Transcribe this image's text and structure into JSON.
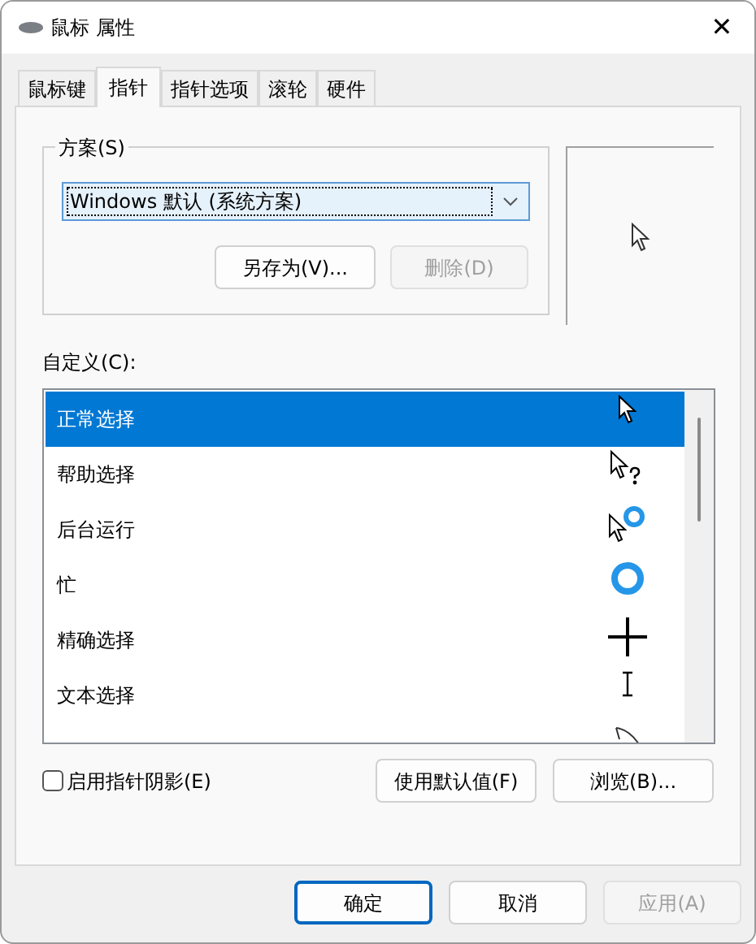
{
  "window": {
    "title": "鼠标 属性",
    "close": "✕"
  },
  "tabs": [
    {
      "label": "鼠标键",
      "selected": false
    },
    {
      "label": "指针",
      "selected": true
    },
    {
      "label": "指针选项",
      "selected": false
    },
    {
      "label": "滚轮",
      "selected": false
    },
    {
      "label": "硬件",
      "selected": false
    }
  ],
  "scheme": {
    "label": "方案(S)",
    "value": "Windows 默认 (系统方案)",
    "buttons": [
      {
        "label": "另存为(V)...",
        "disabled": false
      },
      {
        "label": "删除(D)",
        "disabled": true
      }
    ]
  },
  "customize": {
    "label": "自定义(C):",
    "rows": [
      {
        "label": "正常选择",
        "kind": "arrow",
        "selected": true
      },
      {
        "label": "帮助选择",
        "kind": "help",
        "selected": false
      },
      {
        "label": "后台运行",
        "kind": "working",
        "selected": false
      },
      {
        "label": "忙",
        "kind": "busy",
        "selected": false
      },
      {
        "label": "精确选择",
        "kind": "cross",
        "selected": false
      },
      {
        "label": "文本选择",
        "kind": "text",
        "selected": false
      },
      {
        "kind": "pen",
        "selected": false
      }
    ]
  },
  "shadow": {
    "label": "启用指针阴影(E)",
    "checked": false
  },
  "list_buttons": [
    "使用默认值(F)",
    "浏览(B)..."
  ],
  "footer_buttons": [
    {
      "label": "确定",
      "focused": true,
      "disabled": false
    },
    {
      "label": "取消",
      "focused": false,
      "disabled": false
    },
    {
      "label": "应用(A)",
      "focused": false,
      "disabled": true
    }
  ]
}
